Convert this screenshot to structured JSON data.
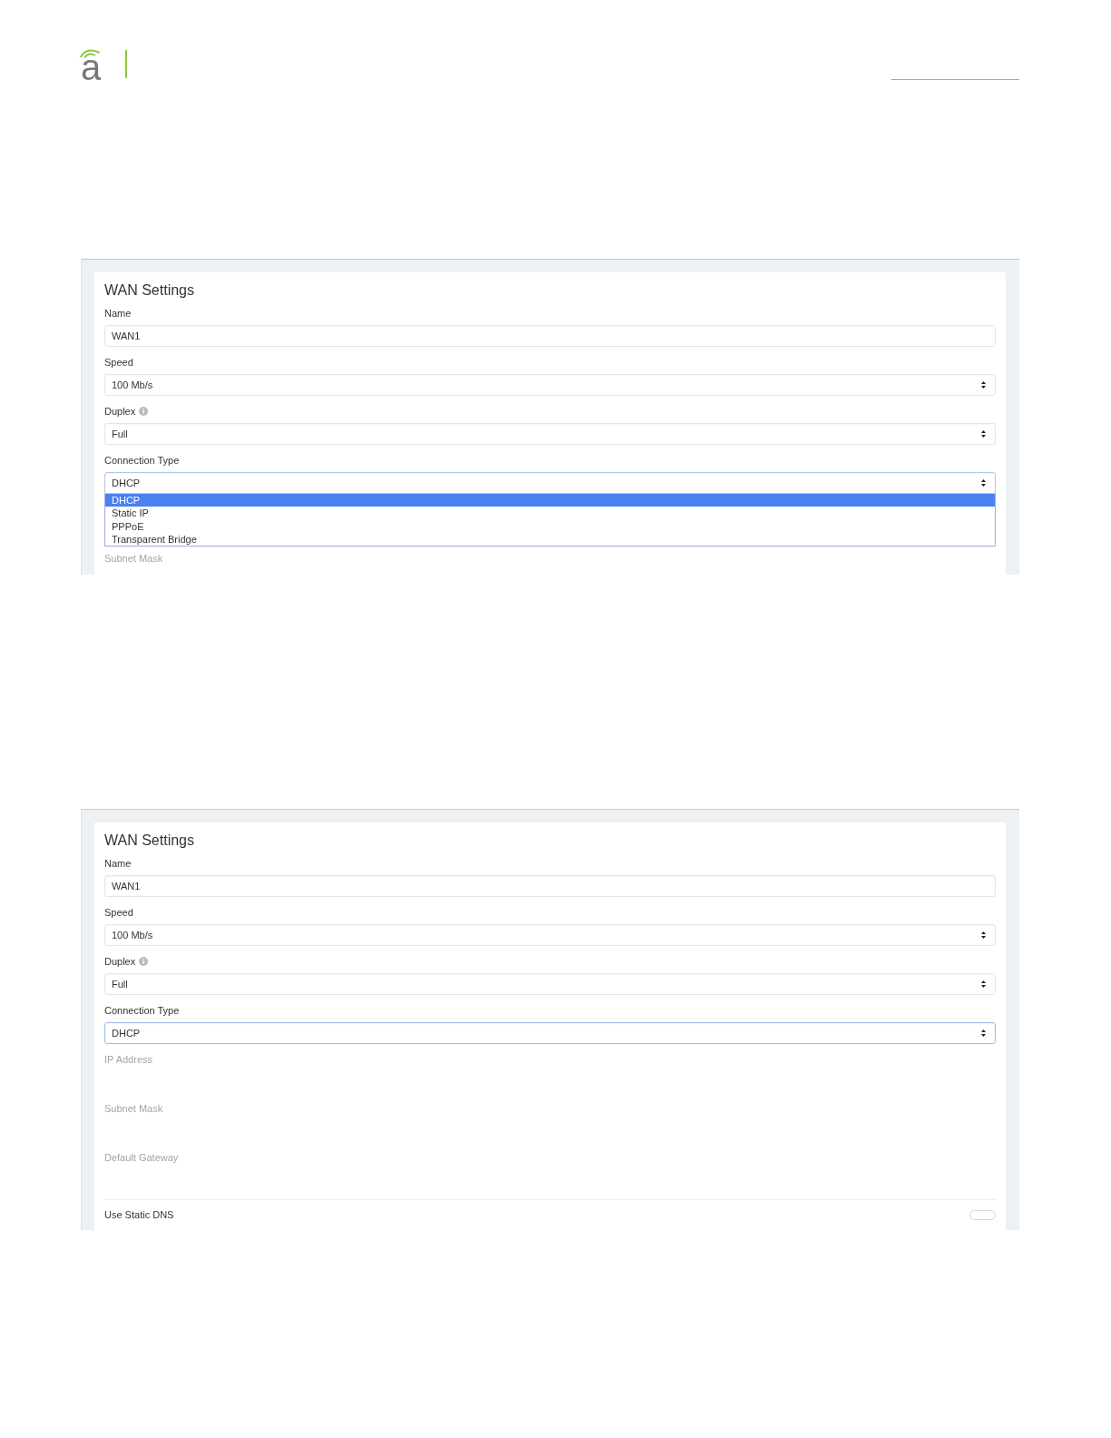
{
  "header": {
    "logo_text": "a"
  },
  "screenshots": [
    {
      "title": "WAN Settings",
      "fields": [
        {
          "kind": "text",
          "label": "Name",
          "value": "WAN1",
          "focused": false
        },
        {
          "kind": "select",
          "label": "Speed",
          "value": "100 Mb/s",
          "focused": false
        },
        {
          "kind": "select",
          "label": "Duplex",
          "info": true,
          "value": "Full",
          "focused": false
        },
        {
          "kind": "select",
          "label": "Connection Type",
          "value": "DHCP",
          "focused": true,
          "expanded": true,
          "options": [
            {
              "label": "DHCP",
              "selected": true
            },
            {
              "label": "Static IP",
              "selected": false
            },
            {
              "label": "PPPoE",
              "selected": false
            },
            {
              "label": "Transparent Bridge",
              "selected": false
            }
          ]
        },
        {
          "kind": "text",
          "label": "Subnet Mask",
          "disabled": true
        }
      ]
    },
    {
      "title": "WAN Settings",
      "fields": [
        {
          "kind": "text",
          "label": "Name",
          "value": "WAN1",
          "focused": false
        },
        {
          "kind": "select",
          "label": "Speed",
          "value": "100 Mb/s",
          "focused": false
        },
        {
          "kind": "select",
          "label": "Duplex",
          "info": true,
          "value": "Full",
          "focused": false
        },
        {
          "kind": "select",
          "label": "Connection Type",
          "value": "DHCP",
          "focused": true,
          "expanded": false
        },
        {
          "kind": "text",
          "label": "IP Address",
          "disabled": true
        },
        {
          "kind": "text",
          "label": "Subnet Mask",
          "disabled": true
        },
        {
          "kind": "text",
          "label": "Default Gateway",
          "disabled": true
        },
        {
          "kind": "toggle",
          "label": "Use Static DNS",
          "on": false
        }
      ]
    }
  ]
}
